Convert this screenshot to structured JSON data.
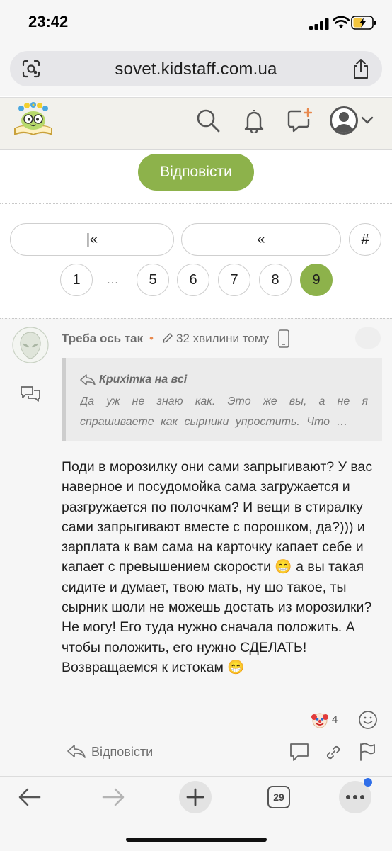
{
  "status_bar": {
    "time": "23:42"
  },
  "browser": {
    "url": "sovet.kidstaff.com.ua",
    "tab_count": "29"
  },
  "site": {
    "reply_button_label": "Відповісти"
  },
  "pagination": {
    "first_label": "|«",
    "prev_label": "«",
    "jump_label": "#",
    "ellipsis": "…",
    "pages": [
      "1",
      "5",
      "6",
      "7",
      "8",
      "9"
    ],
    "current": "9"
  },
  "post": {
    "author": "Треба ось так",
    "online_marker": "•",
    "time": "32 хвилини тому",
    "quote": {
      "author": "Крихітка на всі",
      "text": "Да уж не знаю как. Это же вы, а не я спрашиваете как сырники упростить. Что …"
    },
    "body": "Поди в морозилку они сами запрыгивают? У вас наверное и посудомойка сама загружается и разгружается по полочкам? И вещи в стиралку сами запрыгивают вместе с порошком, да?))) и зарплата к вам сама на карточку капает себе и капает с превышением скорости 😁 а вы такая сидите и думает, твою мать, ну шо такое, ты сырник шоли не можешь достать из морозилки? Не могу! Его туда нужно сначала положить. А чтобы положить, его нужно СДЕЛАТЬ! Возвращаемся к истокам 😁",
    "reaction_count": "4",
    "reply_label": "Відповісти"
  },
  "colors": {
    "accent": "#8db24b",
    "online": "#e8894e",
    "notification": "#2f6ee8"
  }
}
